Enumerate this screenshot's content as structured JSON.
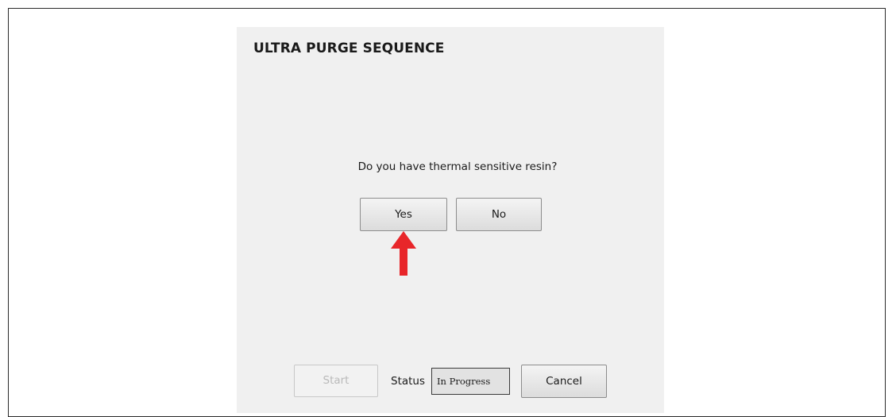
{
  "dialog": {
    "title": "ULTRA PURGE SEQUENCE",
    "question": "Do you have thermal sensitive resin?",
    "yes_label": "Yes",
    "no_label": "No",
    "start_label": "Start",
    "status_label": "Status",
    "status_value": "In Progress",
    "cancel_label": "Cancel"
  },
  "colors": {
    "dialog_background": "#f0f0f0",
    "annotation_arrow": "#e8262a",
    "disabled_text": "#b9b9b9"
  },
  "icons": {
    "annotation": "red-up-arrow-icon"
  }
}
